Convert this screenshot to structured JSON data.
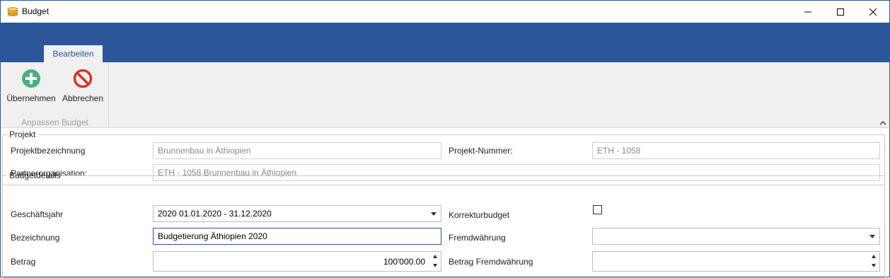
{
  "window": {
    "title": "Budget",
    "icon": "coins-icon",
    "controls": [
      "minimize-icon",
      "maximize-icon",
      "close-icon"
    ]
  },
  "ribbon": {
    "tab_label": "Bearbeiten",
    "group_label": "Anpassen Budget",
    "buttons": {
      "ok_label": "Übernehmen",
      "cancel_label": "Abbrechen"
    },
    "colors": {
      "ribbon_blue": "#2b579a",
      "ok_green": "#4caf7d",
      "cancel_red": "#d9352b"
    }
  },
  "projekt": {
    "legend": "Projekt",
    "projektbezeichnung_label": "Projektbezeichnung",
    "projektbezeichnung_value": "Brunnenbau in Äthiopien",
    "projektnummer_label": "Projekt-Nummer:",
    "projektnummer_value": "ETH - 1058",
    "partner_label": "Partnerorganisation:",
    "partner_value": "ETH - 1058 Brunnenbau in Äthiopien"
  },
  "budgetdetails": {
    "legend": "Budgetdetails",
    "geschaeftsjahr_label": "Geschäftsjahr",
    "geschaeftsjahr_value": "2020 01.01.2020 - 31.12.2020",
    "korrektur_label": "Korrekturbudget",
    "korrektur_checked": false,
    "bezeichnung_label": "Bezeichnung",
    "bezeichnung_value": "Budgetierung Äthiopien 2020",
    "fremdwaehrung_label": "Fremdwährung",
    "fremdwaehrung_value": "",
    "betrag_label": "Betrag",
    "betrag_value": "100'000.00",
    "betrag_fremd_label": "Betrag Fremdwährung",
    "betrag_fremd_value": ""
  }
}
